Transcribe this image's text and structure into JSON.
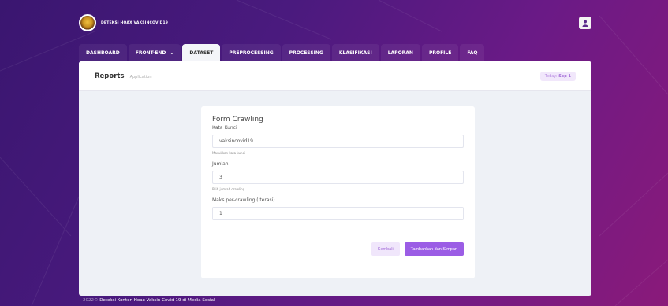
{
  "header": {
    "brand": "DETEKSI HOAX VAKSINCOVID19",
    "user_icon": "user-icon"
  },
  "nav": {
    "items": [
      {
        "label": "DASHBOARD"
      },
      {
        "label": "FRONT-END",
        "has_caret": true
      },
      {
        "label": "DATASET",
        "active": true
      },
      {
        "label": "PREPROCESSING"
      },
      {
        "label": "PROCESSING"
      },
      {
        "label": "KLASIFIKASI"
      },
      {
        "label": "LAPORAN"
      },
      {
        "label": "PROFILE"
      },
      {
        "label": "FAQ"
      }
    ]
  },
  "page": {
    "title": "Reports",
    "subtitle": "Application",
    "today_label": "Today:",
    "today_value": "Sep 1"
  },
  "form": {
    "title": "Form Crawling",
    "keyword_label": "Kata Kunci",
    "keyword_value": "vaksincovid19",
    "keyword_hint": "Masukkan kata kunci",
    "amount_label": "Jumlah",
    "amount_value": "3",
    "amount_hint": "Pilih jumlah crawling",
    "max_label": "Maks per-crawling (iterasi)",
    "max_value": "1",
    "back_label": "Kembali",
    "save_label": "Tambahkan dan Simpan"
  },
  "footer": {
    "year": "2022©",
    "text": "Deteksi Konten Hoax Vaksin Covid-19 di Media Sosial"
  },
  "colors": {
    "accent": "#9b5de5",
    "bg_gradient_start": "#3a1670",
    "bg_gradient_end": "#8a1a7a"
  }
}
